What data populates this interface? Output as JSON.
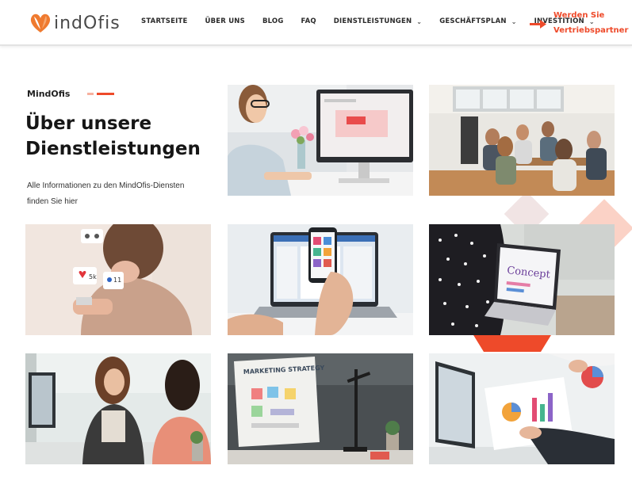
{
  "header": {
    "logo_text": "indOfis",
    "nav": [
      {
        "label": "STARTSEITE",
        "dropdown": false
      },
      {
        "label": "ÜBER UNS",
        "dropdown": false
      },
      {
        "label": "BLOG",
        "dropdown": false
      },
      {
        "label": "FAQ",
        "dropdown": false
      },
      {
        "label": "DIENSTLEISTUNGEN",
        "dropdown": true
      },
      {
        "label": "GESCHÄFTSPLAN",
        "dropdown": true
      },
      {
        "label": "INVESTITION",
        "dropdown": true
      }
    ],
    "cta_line1": "Werden Sie",
    "cta_line2": "Vertriebspartner"
  },
  "intro": {
    "brand": "MindOfis",
    "headline_line1": "Über unsere",
    "headline_line2": "Dienstleistungen",
    "description_line1": "Alle Informationen zu den MindOfis-Diensten",
    "description_line2": "finden Sie hier"
  },
  "images": {
    "social_badge_like": "5k",
    "social_badge_user": "11",
    "concept_word": "Concept",
    "marketing_word": "MARKETING STRATEGY"
  },
  "colors": {
    "accent": "#ee4a2a",
    "accent_light": "#f7b19f",
    "logo_heart": "#ef7a2f"
  }
}
